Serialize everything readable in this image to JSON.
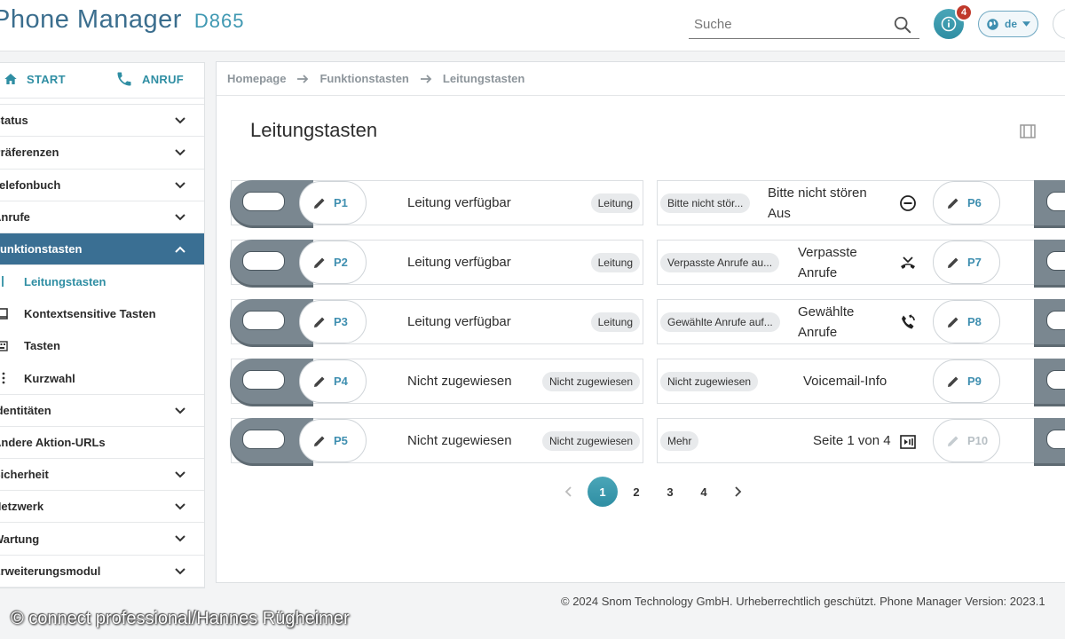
{
  "header": {
    "brand": "Phone Manager",
    "model": "D865",
    "search_placeholder": "Suche",
    "notification_count": "4",
    "language": "de"
  },
  "sidebar": {
    "quick": {
      "start": "START",
      "call": "ANRUF"
    },
    "items": [
      {
        "label": "Status"
      },
      {
        "label": "Präferenzen"
      },
      {
        "label": "Telefonbuch"
      },
      {
        "label": "Anrufe"
      },
      {
        "label": "Funktionstasten"
      },
      {
        "label": "Identitäten"
      },
      {
        "label": "Andere Aktion-URLs"
      },
      {
        "label": "Sicherheit"
      },
      {
        "label": "Netzwerk"
      },
      {
        "label": "Wartung"
      },
      {
        "label": "Erweiterungsmodul"
      }
    ],
    "subitems": [
      {
        "label": "Leitungstasten"
      },
      {
        "label": "Kontextsensitive Tasten"
      },
      {
        "label": "Tasten"
      },
      {
        "label": "Kurzwahl"
      }
    ]
  },
  "breadcrumb": [
    "Homepage",
    "Funktionstasten",
    "Leitungstasten"
  ],
  "page": {
    "title": "Leitungstasten"
  },
  "left_keys": [
    {
      "id": "P1",
      "text": "Leitung verfügbar",
      "tag": "Leitung"
    },
    {
      "id": "P2",
      "text": "Leitung verfügbar",
      "tag": "Leitung"
    },
    {
      "id": "P3",
      "text": "Leitung verfügbar",
      "tag": "Leitung"
    },
    {
      "id": "P4",
      "text": "Nicht zugewiesen",
      "tag": "Nicht zugewiesen"
    },
    {
      "id": "P5",
      "text": "Nicht zugewiesen",
      "tag": "Nicht zugewiesen"
    }
  ],
  "right_keys": [
    {
      "id": "P6",
      "tag": "Bitte nicht stör...",
      "line1": "Bitte nicht stören",
      "line2": "Aus",
      "icon": "dnd-icon"
    },
    {
      "id": "P7",
      "tag": "Verpasste Anrufe au...",
      "line1": "Verpasste",
      "line2": "Anrufe",
      "icon": "missed-call-icon"
    },
    {
      "id": "P8",
      "tag": "Gewählte Anrufe auf...",
      "line1": "Gewählte",
      "line2": "Anrufe",
      "icon": "dialed-call-icon"
    },
    {
      "id": "P9",
      "tag": "Nicht zugewiesen",
      "line1": "Voicemail-Info",
      "line2": "",
      "icon": ""
    },
    {
      "id": "P10",
      "tag": "Mehr",
      "line1": "Seite 1 von 4",
      "line2": "",
      "icon": "page-icon"
    }
  ],
  "pagination": {
    "pages": [
      "1",
      "2",
      "3",
      "4"
    ],
    "current": "1"
  },
  "footer": "© 2024 Snom Technology GmbH. Urheberrechtlich geschützt. Phone Manager Version: 2023.1",
  "watermark": "© connect professional/Hannes Rügheimer",
  "colors": {
    "accent": "#2f8ea3",
    "nav_active": "#3a6f93",
    "key_grey": "#7a8790",
    "badge": "#c0392b"
  }
}
